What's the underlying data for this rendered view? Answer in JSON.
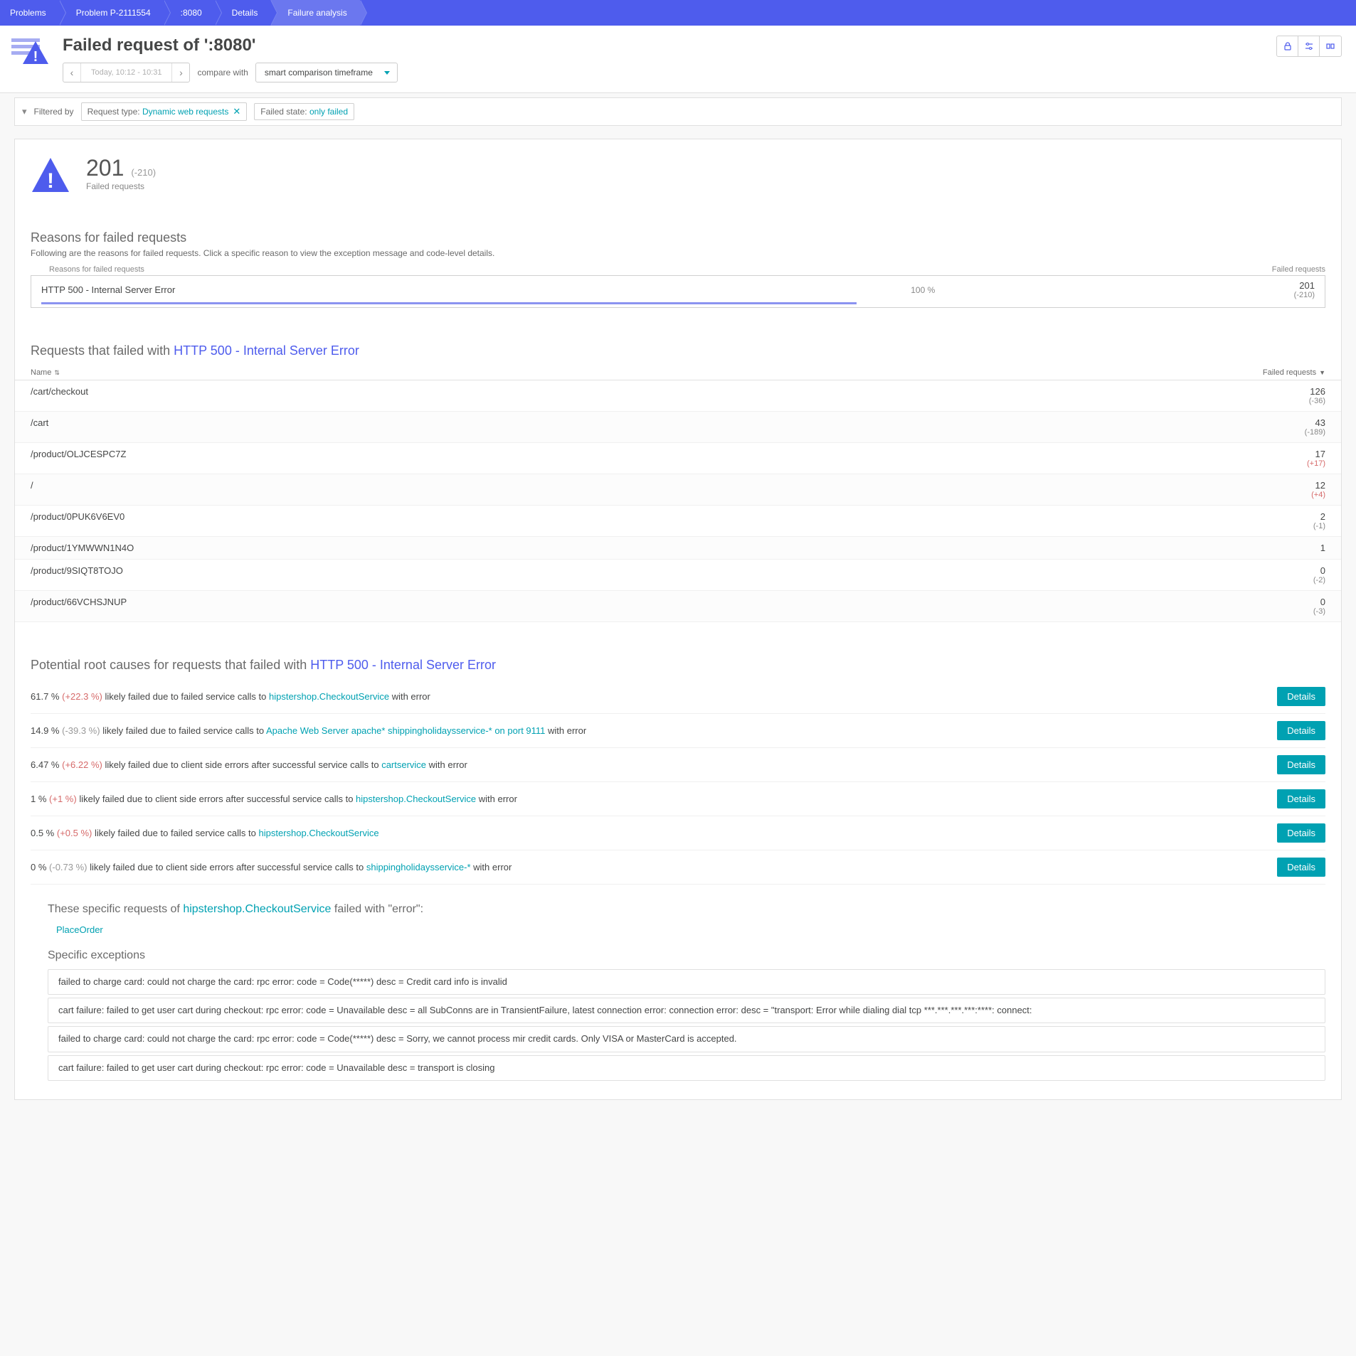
{
  "breadcrumbs": [
    {
      "label": "Problems"
    },
    {
      "label": "Problem P-2111554"
    },
    {
      "label": ":8080"
    },
    {
      "label": "Details"
    },
    {
      "label": "Failure analysis"
    }
  ],
  "header": {
    "title": "Failed request of ':8080'",
    "time_range": "Today, 10:12 - 10:31",
    "compare_label": "compare with",
    "compare_value": "smart comparison timeframe"
  },
  "filters": {
    "label": "Filtered by",
    "items": [
      {
        "type": "Request type",
        "value": "Dynamic web requests",
        "removable": true
      },
      {
        "type": "Failed state",
        "value": "only failed",
        "removable": false
      }
    ]
  },
  "stat": {
    "value": "201",
    "delta": "(-210)",
    "label": "Failed requests"
  },
  "reasons": {
    "title": "Reasons for failed requests",
    "subtitle": "Following are the reasons for failed requests. Click a specific reason to view the exception message and code-level details.",
    "col1": "Reasons for failed requests",
    "col2": "Failed requests",
    "rows": [
      {
        "name": "HTTP 500 - Internal Server Error",
        "pct": "100 %",
        "count": "201",
        "delta": "(-210)"
      }
    ]
  },
  "failed_requests_table": {
    "title_prefix": "Requests that failed with ",
    "title_link": "HTTP 500 - Internal Server Error",
    "col_name": "Name",
    "col_count": "Failed requests",
    "rows": [
      {
        "name": "/cart/checkout",
        "count": "126",
        "delta": "(-36)",
        "red": false
      },
      {
        "name": "/cart",
        "count": "43",
        "delta": "(-189)",
        "red": false
      },
      {
        "name": "/product/OLJCESPC7Z",
        "count": "17",
        "delta": "(+17)",
        "red": true
      },
      {
        "name": "/",
        "count": "12",
        "delta": "(+4)",
        "red": true
      },
      {
        "name": "/product/0PUK6V6EV0",
        "count": "2",
        "delta": "(-1)",
        "red": false
      },
      {
        "name": "/product/1YMWWN1N4O",
        "count": "1",
        "delta": "",
        "red": false
      },
      {
        "name": "/product/9SIQT8TOJO",
        "count": "0",
        "delta": "(-2)",
        "red": false
      },
      {
        "name": "/product/66VCHSJNUP",
        "count": "0",
        "delta": "(-3)",
        "red": false
      }
    ]
  },
  "root_causes": {
    "title_prefix": "Potential root causes for requests that failed with ",
    "title_link": "HTTP 500 - Internal Server Error",
    "details_label": "Details",
    "rows": [
      {
        "pct": "61.7 %",
        "pct_delta": "(+22.3 %)",
        "delta_class": "red",
        "text_before": " likely failed due to failed service calls to ",
        "link": "hipstershop.CheckoutService",
        "text_after": " with error"
      },
      {
        "pct": "14.9 %",
        "pct_delta": "(-39.3 %)",
        "delta_class": "grey",
        "text_before": " likely failed due to failed service calls to ",
        "link": "Apache Web Server apache* shippingholidaysservice-* on port 9111",
        "text_after": " with error"
      },
      {
        "pct": "6.47 %",
        "pct_delta": "(+6.22 %)",
        "delta_class": "red",
        "text_before": " likely failed due to client side errors after successful service calls to ",
        "link": "cartservice",
        "text_after": " with error"
      },
      {
        "pct": "1 %",
        "pct_delta": "(+1 %)",
        "delta_class": "red",
        "text_before": " likely failed due to client side errors after successful service calls to ",
        "link": "hipstershop.CheckoutService",
        "text_after": " with error"
      },
      {
        "pct": "0.5 %",
        "pct_delta": "(+0.5 %)",
        "delta_class": "red",
        "text_before": " likely failed due to failed service calls to ",
        "link": "hipstershop.CheckoutService",
        "text_after": ""
      },
      {
        "pct": "0 %",
        "pct_delta": "(-0.73 %)",
        "delta_class": "grey",
        "text_before": " likely failed due to client side errors after successful service calls to ",
        "link": "shippingholidaysservice-*",
        "text_after": " with error"
      }
    ]
  },
  "exceptions": {
    "title_prefix": "These specific requests of ",
    "title_link": "hipstershop.CheckoutService",
    "title_suffix": " failed with \"error\":",
    "request_link": "PlaceOrder",
    "subtitle": "Specific exceptions",
    "items": [
      "failed to charge card: could not charge the card: rpc error: code = Code(*****) desc = Credit card info is invalid",
      "cart failure: failed to get user cart during checkout: rpc error: code = Unavailable desc = all SubConns are in TransientFailure, latest connection error: connection error: desc = \"transport: Error while dialing dial tcp ***.***.***.***:****: connect:",
      "failed to charge card: could not charge the card: rpc error: code = Code(*****) desc = Sorry, we cannot process mir credit cards. Only VISA or MasterCard is accepted.",
      "cart failure: failed to get user cart during checkout: rpc error: code = Unavailable desc = transport is closing"
    ]
  }
}
